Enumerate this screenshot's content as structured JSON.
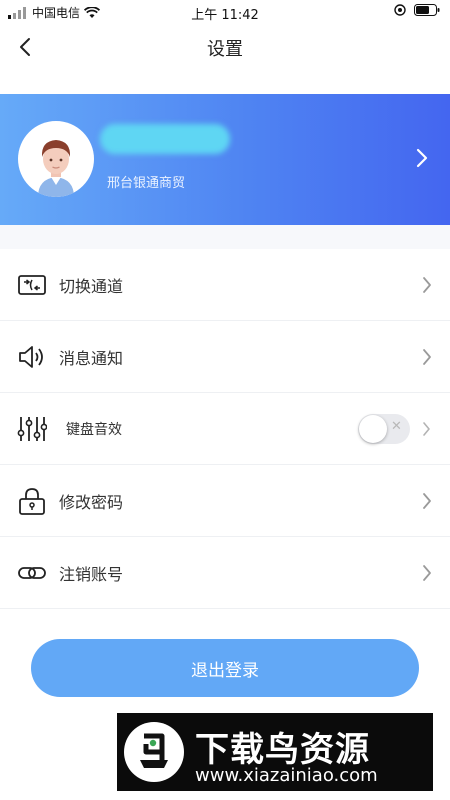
{
  "status_bar": {
    "carrier": "中国电信",
    "time": "上午 11:42"
  },
  "header": {
    "title": "设置"
  },
  "profile": {
    "company": "邢台银通商贸"
  },
  "menu": {
    "items": [
      {
        "label": "切换通道",
        "icon": "channel-switch-icon"
      },
      {
        "label": "消息通知",
        "icon": "speaker-icon"
      },
      {
        "label": "键盘音效",
        "icon": "sliders-icon",
        "toggle": false
      },
      {
        "label": "修改密码",
        "icon": "lock-icon"
      },
      {
        "label": "注销账号",
        "icon": "link-icon"
      }
    ]
  },
  "logout": {
    "label": "退出登录"
  },
  "watermark": {
    "title": "下载鸟资源",
    "url": "www.xiazainiao.com"
  },
  "colors": {
    "profile_gradient_start": "#66aaf8",
    "profile_gradient_end": "#4466f0",
    "logout_button": "#62a8f6"
  }
}
